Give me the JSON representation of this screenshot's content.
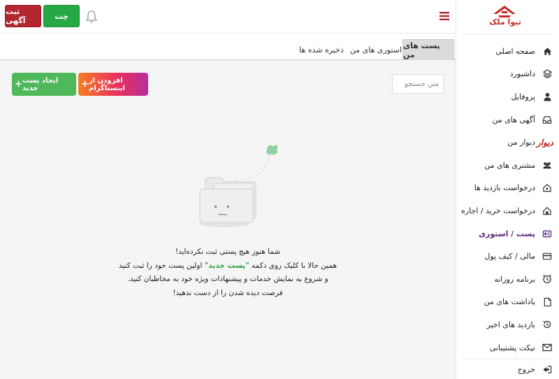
{
  "brand": {
    "logo_text": "تیوا ملک",
    "primary_color": "#c62828"
  },
  "header": {
    "post_ad_label": "ثبت آگهی",
    "chat_label": "چت",
    "post_ad_color": "#b3262d",
    "chat_color": "#26a845"
  },
  "sidebar": {
    "items": [
      {
        "label": "صفحه اصلی",
        "icon": "home-icon"
      },
      {
        "label": "داشبورد",
        "icon": "layers-icon"
      },
      {
        "label": "پروفایل",
        "icon": "user-icon"
      },
      {
        "label": "آگهی های من",
        "icon": "inbox-icon"
      },
      {
        "label": "دیوار من",
        "brand": "دیوار"
      },
      {
        "label": "مشتری های من",
        "icon": "users-icon"
      },
      {
        "label": "درخواست بازدید ها",
        "icon": "house-visit-icon"
      },
      {
        "label": "درخواست خرید / اجاره",
        "icon": "house-request-icon"
      },
      {
        "label": "پست / استوری",
        "icon": "instagram-post-icon",
        "active": true
      },
      {
        "label": "مالی / کیف پول",
        "icon": "wallet-icon"
      },
      {
        "label": "برنامه روزانه",
        "icon": "alarm-clock-icon"
      },
      {
        "label": "یاداشت های من",
        "icon": "note-icon"
      },
      {
        "label": "بازدید های اخیر",
        "icon": "history-icon"
      },
      {
        "label": "تیکت پشتیبانی",
        "icon": "envelope-icon"
      }
    ],
    "logout_label": "خروج",
    "active_color": "#5d2a7e"
  },
  "tabs": [
    {
      "label": "پست های من",
      "active": true
    },
    {
      "label": "استوری های من",
      "active": false
    },
    {
      "label": "ذخیره شده ها",
      "active": false
    }
  ],
  "search": {
    "placeholder": "متن جستجو"
  },
  "actions": {
    "instagram_label": "افزودن از اینستاگرام",
    "new_post_label": "ایجاد پست جدید"
  },
  "empty_state": {
    "line1": "شما هنوز هیچ پستی ثبت نکرده‌اید!",
    "line2_before": "همین حالا با کلیک روی دکمه ",
    "line2_highlight": "\"پست جدید\"",
    "line2_after": " اولین پست خود را ثبت کنید",
    "line3": "و شروع به نمایش خدمات و پیشنهادات ویژه خود به مخاطبان کنید.",
    "line4": "فرصت دیده شدن را از دست ندهید!"
  }
}
